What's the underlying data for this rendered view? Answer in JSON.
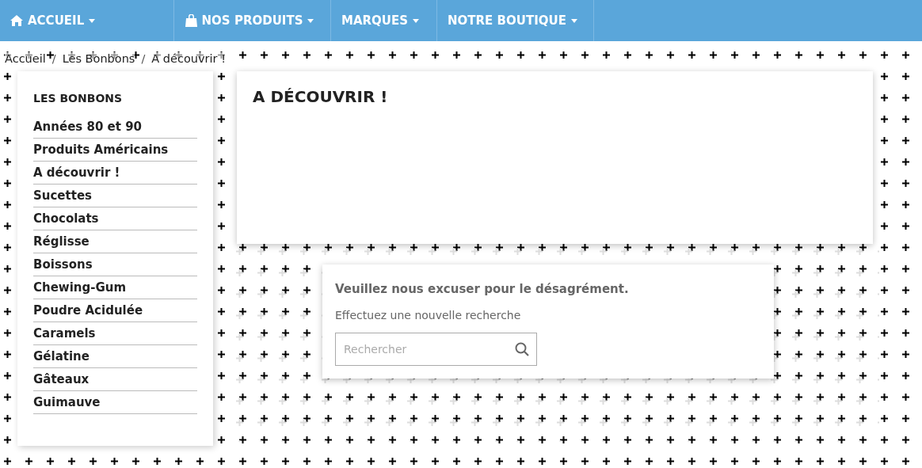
{
  "nav": [
    {
      "label": "ACCUEIL",
      "kind": "home"
    },
    {
      "label": "NOS PRODUITS",
      "kind": "bag"
    },
    {
      "label": "MARQUES",
      "kind": "plain"
    },
    {
      "label": "NOTRE BOUTIQUE",
      "kind": "plain"
    }
  ],
  "breadcrumb": [
    {
      "label": "Accueil"
    },
    {
      "separator": "/",
      "label": "Les Bonbons"
    },
    {
      "separator": "/",
      "label": "A découvrir !"
    }
  ],
  "sidebar": {
    "title": "LES BONBONS",
    "items": [
      "Années 80 et 90",
      "Produits Américains",
      "A découvrir !",
      "Sucettes",
      "Chocolats",
      "Réglisse",
      "Boissons",
      "Chewing-Gum",
      "Poudre Acidulée",
      "Caramels",
      "Gélatine",
      "Gâteaux",
      "Guimauve"
    ]
  },
  "category": {
    "title": "A DÉCOUVRIR !"
  },
  "notice": {
    "title": "Veuillez nous excuser pour le désagrément.",
    "text": "Effectuez une nouvelle recherche",
    "search": {
      "placeholder": "Rechercher"
    }
  }
}
